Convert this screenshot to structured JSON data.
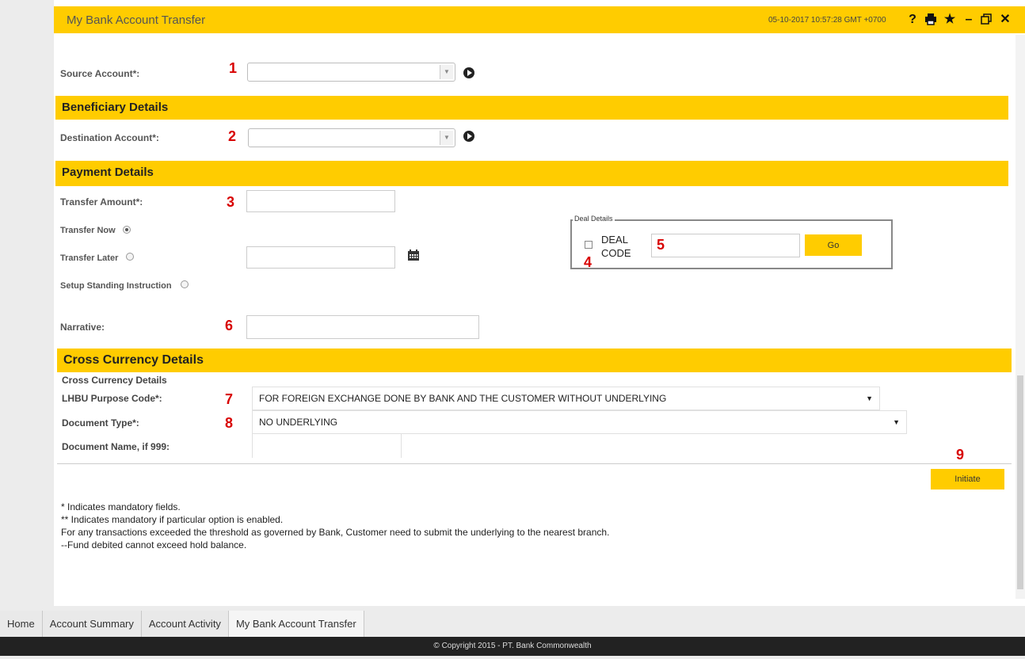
{
  "header": {
    "title": "My Bank Account Transfer",
    "timestamp": "05-10-2017 10:57:28 GMT +0700",
    "icons": [
      "help-icon",
      "print-icon",
      "favorite-star-icon",
      "minimize-icon",
      "restore-icon",
      "close-icon"
    ]
  },
  "source": {
    "label": "Source Account*:",
    "marker": "1"
  },
  "beneficiary": {
    "heading": "Beneficiary Details",
    "dest_label": "Destination Account*:",
    "marker": "2"
  },
  "payment": {
    "heading": "Payment Details",
    "amount_label": "Transfer Amount*:",
    "amount_marker": "3",
    "transfer_now": "Transfer Now",
    "transfer_later": "Transfer Later",
    "standing": "Setup Standing Instruction",
    "narrative_label": "Narrative:",
    "narrative_marker": "6",
    "deal": {
      "legend": "Deal Details",
      "code_line1": "DEAL",
      "code_line2": "CODE",
      "checkbox_marker": "4",
      "input_marker": "5",
      "go_label": "Go"
    }
  },
  "cross": {
    "heading": "Cross Currency Details",
    "subheading": "Cross Currency Details",
    "purpose_label": "LHBU Purpose Code*:",
    "purpose_marker": "7",
    "purpose_value": "FOR FOREIGN EXCHANGE DONE BY BANK AND THE CUSTOMER WITHOUT UNDERLYING",
    "doctype_label": "Document Type*:",
    "doctype_marker": "8",
    "doctype_value": "NO UNDERLYING",
    "docname_label": "Document Name, if 999:",
    "initiate_marker": "9",
    "initiate_label": "Initiate"
  },
  "notes": {
    "line1": "* Indicates mandatory fields.",
    "line2": "** Indicates mandatory if particular option is enabled.",
    "line3": "For any transactions exceeded the threshold as governed by Bank, Customer need to submit the underlying to the nearest branch.",
    "line4": "--Fund debited cannot exceed hold balance."
  },
  "footer": {
    "tabs": [
      "Home",
      "Account Summary",
      "Account Activity",
      "My Bank Account Transfer"
    ],
    "copyright": "© Copyright 2015 - PT. Bank Commonwealth"
  },
  "colors": {
    "accent": "#ffcc00",
    "marker": "#d80000",
    "footer": "#222222"
  }
}
